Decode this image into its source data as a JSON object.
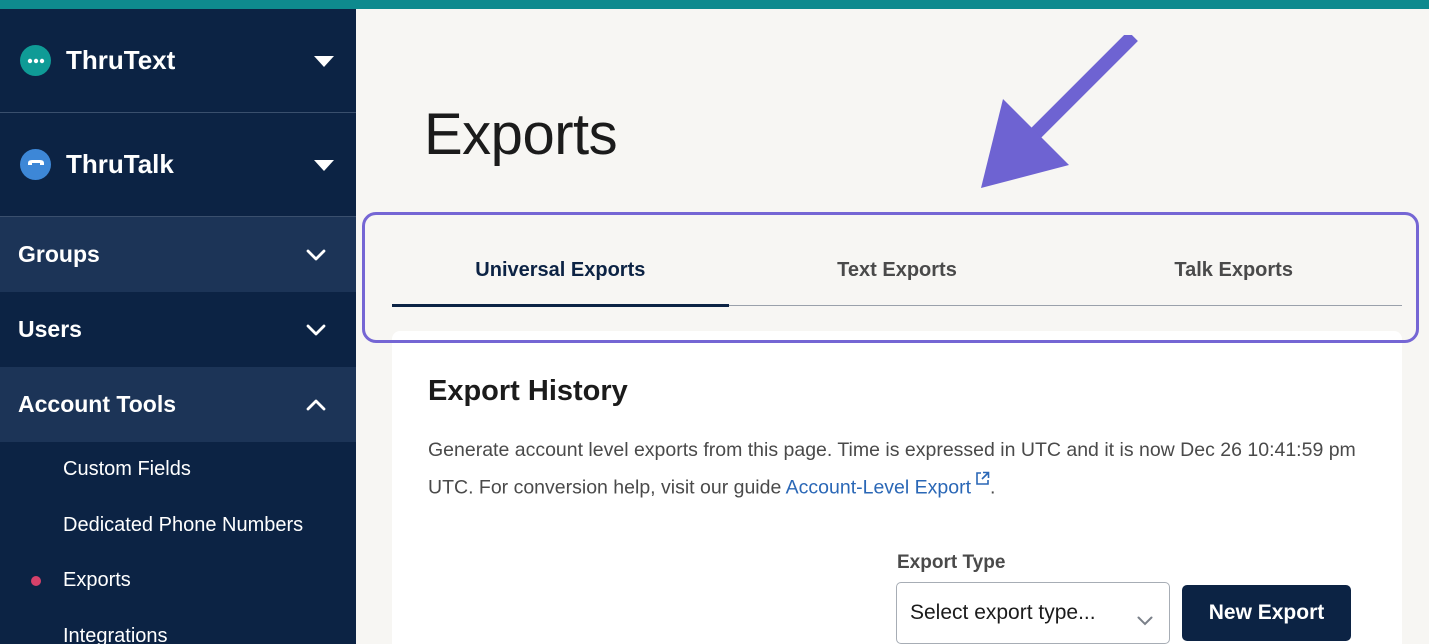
{
  "sidebar": {
    "products": [
      {
        "name": "ThruText",
        "icon": "thrutext-logo-icon",
        "color": "#0f9b96"
      },
      {
        "name": "ThruTalk",
        "icon": "thrutalk-logo-icon",
        "color": "#3d87d7"
      }
    ],
    "sections": [
      {
        "label": "Groups",
        "expanded": false
      },
      {
        "label": "Users",
        "expanded": false
      },
      {
        "label": "Account Tools",
        "expanded": true
      }
    ],
    "account_tools_items": [
      {
        "label": "Custom Fields",
        "active": false
      },
      {
        "label": "Dedicated Phone Numbers",
        "active": false
      },
      {
        "label": "Exports",
        "active": true
      },
      {
        "label": "Integrations",
        "active": false
      }
    ]
  },
  "page": {
    "title": "Exports",
    "tabs": [
      {
        "label": "Universal Exports",
        "active": true
      },
      {
        "label": "Text Exports",
        "active": false
      },
      {
        "label": "Talk Exports",
        "active": false
      }
    ]
  },
  "card": {
    "title": "Export History",
    "description": "Generate account level exports from this page. Time is expressed in UTC and it is now Dec 26 10:41:59 pm UTC. For conversion help, visit our guide ",
    "link_text": "Account-Level Export",
    "after_link": ".",
    "export_type_label": "Export Type",
    "select_placeholder": "Select export type...",
    "new_export_button": "New Export"
  },
  "colors": {
    "sidebar_bg": "#0c2344",
    "accent_highlight": "#7566d4",
    "active_dot": "#d6416a",
    "link": "#2a67b6"
  }
}
